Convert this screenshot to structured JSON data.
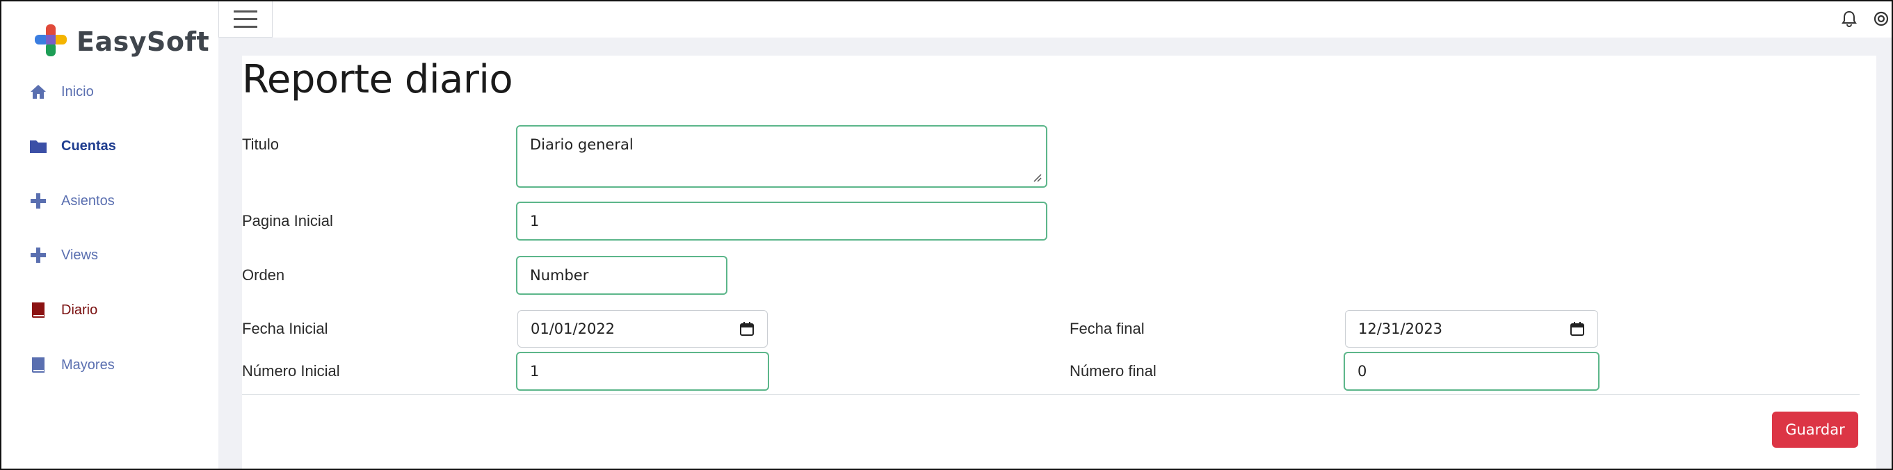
{
  "app": {
    "name": "EasySoft"
  },
  "sidebar": {
    "items": [
      {
        "label": "Inicio",
        "icon": "home-icon"
      },
      {
        "label": "Cuentas",
        "icon": "folder-icon"
      },
      {
        "label": "Asientos",
        "icon": "plus-icon"
      },
      {
        "label": "Views",
        "icon": "plus-icon"
      },
      {
        "label": "Diario",
        "icon": "book-icon",
        "active": true
      },
      {
        "label": "Mayores",
        "icon": "ledger-icon"
      }
    ]
  },
  "topbar": {
    "icons": [
      "menu-icon",
      "bell-icon",
      "settings-icon"
    ]
  },
  "page": {
    "title": "Reporte diario"
  },
  "form": {
    "titulo_label": "Titulo",
    "titulo_value": "Diario general",
    "pagina_inicial_label": "Pagina Inicial",
    "pagina_inicial_value": "1",
    "orden_label": "Orden",
    "orden_value": "Number",
    "fecha_inicial_label": "Fecha Inicial",
    "fecha_inicial_value": "01/01/2022",
    "fecha_final_label": "Fecha final",
    "fecha_final_value": "12/31/2023",
    "numero_inicial_label": "Número Inicial",
    "numero_inicial_value": "1",
    "numero_final_label": "Número final",
    "numero_final_value": "0"
  },
  "actions": {
    "save_label": "Guardar"
  },
  "colors": {
    "accent_field_border": "#5cb68a",
    "save_button": "#dc3545",
    "nav_link": "#5a6fb0",
    "nav_active": "#7a1010"
  }
}
